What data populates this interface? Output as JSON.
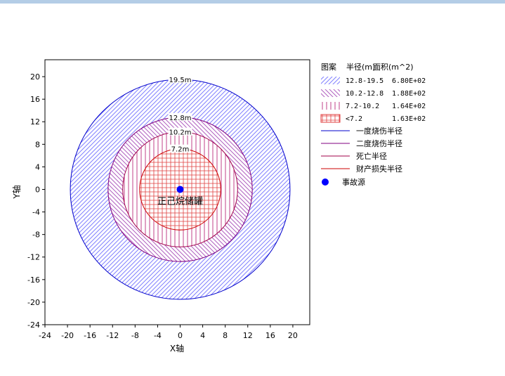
{
  "chart_data": {
    "type": "scatter",
    "xlabel": "X轴",
    "ylabel": "Y轴",
    "xlim": [
      -24,
      23
    ],
    "ylim": [
      -24,
      23
    ],
    "xticks": [
      -24,
      -20,
      -16,
      -12,
      -8,
      -4,
      0,
      4,
      8,
      12,
      16,
      20
    ],
    "yticks": [
      -24,
      -20,
      -16,
      -12,
      -8,
      -4,
      0,
      4,
      8,
      12,
      16,
      20
    ],
    "grid": false,
    "legend_position": "right",
    "source": {
      "label": "正己烷储罐",
      "x": 0,
      "y": 0,
      "color": "#0000ff"
    },
    "rings": [
      {
        "radius": 19.5,
        "label": "19.5m",
        "color": "#0000cc"
      },
      {
        "radius": 12.8,
        "label": "12.8m",
        "color": "#800080"
      },
      {
        "radius": 10.2,
        "label": "10.2m",
        "color": "#a0004a"
      },
      {
        "radius": 7.2,
        "label": "7.2m",
        "color": "#cc0000"
      }
    ],
    "zones": [
      {
        "range": "12.8-19.5",
        "area": "6.80E+02",
        "inner": 12.8,
        "outer": 19.5,
        "pattern": "diag-up",
        "color": "#8080ff"
      },
      {
        "range": "10.2-12.8",
        "area": "1.88E+02",
        "inner": 10.2,
        "outer": 12.8,
        "pattern": "diag-down",
        "color": "#b060c0"
      },
      {
        "range": "7.2-10.2",
        "area": "1.64E+02",
        "inner": 7.2,
        "outer": 10.2,
        "pattern": "vertical",
        "color": "#c0408a"
      },
      {
        "range": "<7.2",
        "area": "1.63E+02",
        "inner": 0,
        "outer": 7.2,
        "pattern": "grid",
        "color": "#e04040"
      }
    ]
  },
  "legend": {
    "header": {
      "pattern": "图案",
      "radius": "半径(m)",
      "area": "面积(m^2)"
    },
    "lines": [
      {
        "label": "一度烧伤半径",
        "color": "#0000cc"
      },
      {
        "label": "二度烧伤半径",
        "color": "#800080"
      },
      {
        "label": "死亡半径",
        "color": "#a0004a"
      },
      {
        "label": "财产损失半径",
        "color": "#cc0000"
      }
    ],
    "source_label": "事故源",
    "source_color": "#0000ff"
  }
}
